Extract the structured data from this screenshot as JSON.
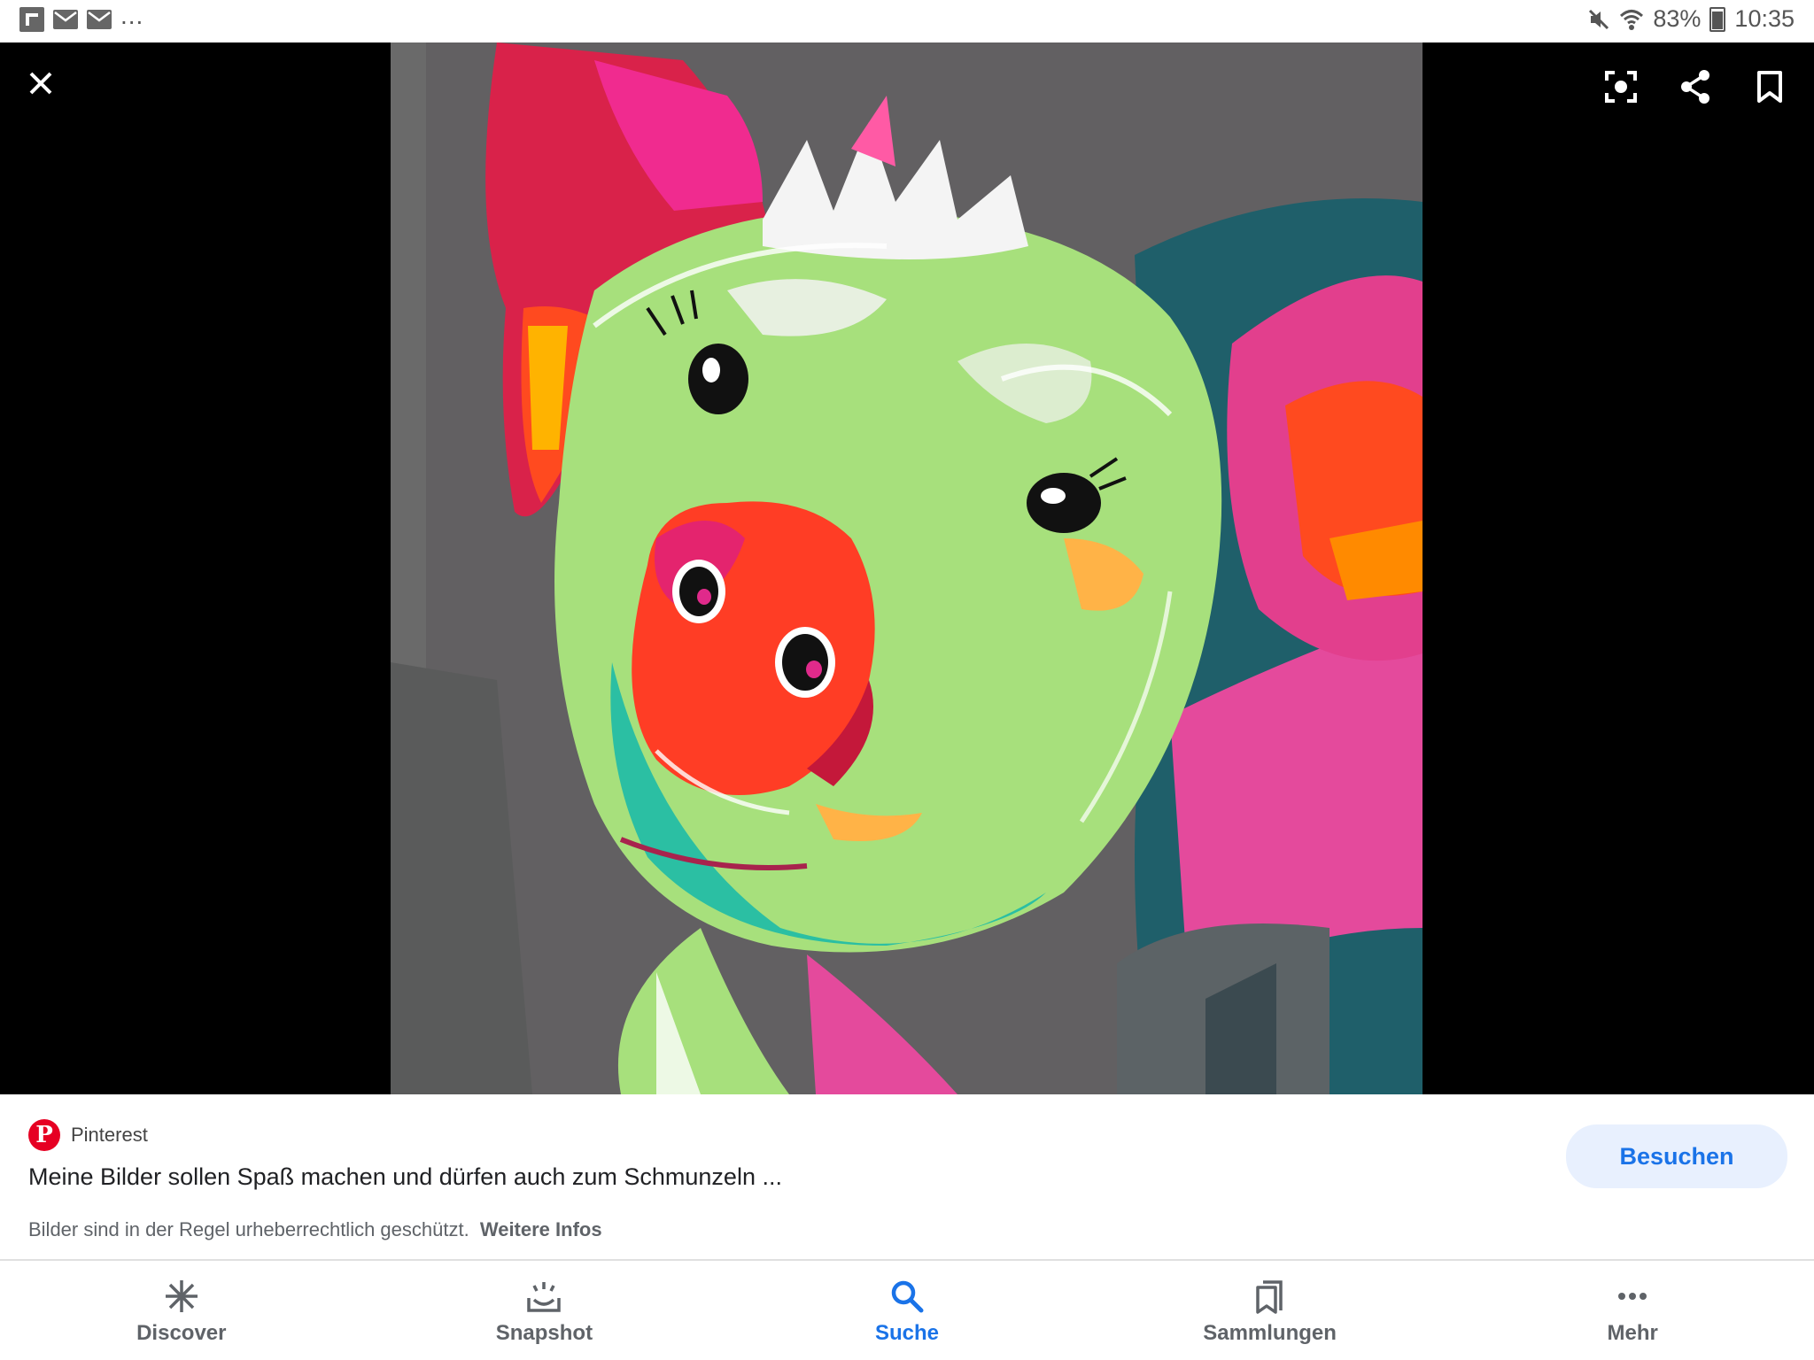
{
  "status_bar": {
    "notification_icons": [
      "flipboard-icon",
      "mail-icon",
      "mail-icon"
    ],
    "overflow": "...",
    "battery": "83%",
    "time": "10:35"
  },
  "viewer": {
    "toolbar": {
      "close_icon": "close-icon",
      "lens_icon": "lens-icon",
      "share_icon": "share-icon",
      "bookmark_icon": "bookmark-icon"
    }
  },
  "result": {
    "source": "Pinterest",
    "title": "Meine Bilder sollen Spaß machen und dürfen auch zum Schmunzeln ...",
    "copyright_text": "Bilder sind in der Regel urheberrechtlich geschützt.",
    "more_info": "Weitere Infos",
    "visit_label": "Besuchen"
  },
  "bottom_nav": {
    "items": [
      {
        "label": "Discover",
        "icon": "asterisk-icon"
      },
      {
        "label": "Snapshot",
        "icon": "snapshot-icon"
      },
      {
        "label": "Suche",
        "icon": "search-icon"
      },
      {
        "label": "Sammlungen",
        "icon": "collections-icon"
      },
      {
        "label": "Mehr",
        "icon": "more-icon"
      }
    ],
    "active_index": 2
  },
  "colors": {
    "accent": "#1a73e8",
    "visit_button_bg": "#e8f0fe",
    "pinterest_red": "#e60023"
  }
}
